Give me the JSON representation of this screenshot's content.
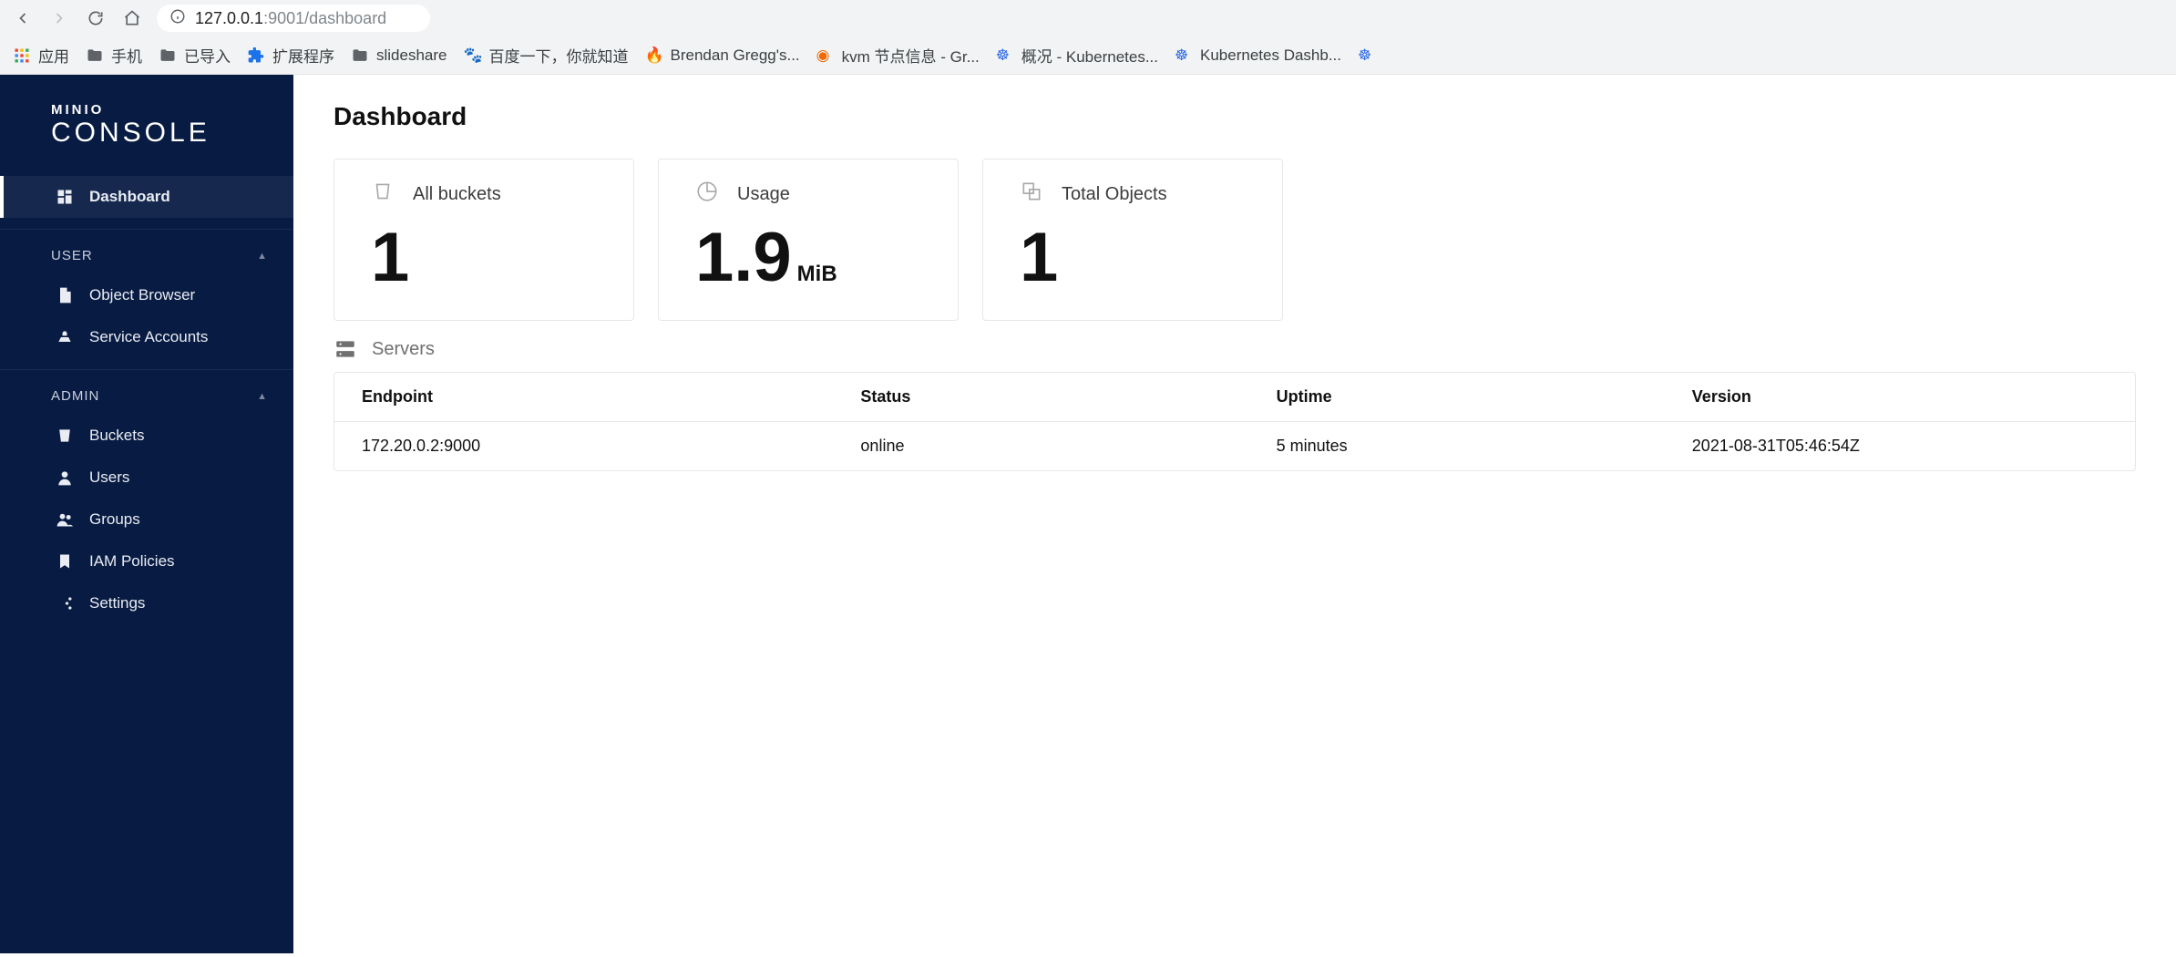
{
  "browser": {
    "url_host": "127.0.0.1",
    "url_port": ":9001",
    "url_path": "/dashboard",
    "bookmarks": [
      "应用",
      "手机",
      "已导入",
      "扩展程序",
      "slideshare",
      "百度一下，你就知道",
      "Brendan Gregg's...",
      "kvm 节点信息 - Gr...",
      "概况 - Kubernetes...",
      "Kubernetes Dashb..."
    ]
  },
  "app": {
    "logo_small": "MINIO",
    "logo_big": "CONSOLE"
  },
  "nav": {
    "dashboard": "Dashboard",
    "section_user": "USER",
    "object_browser": "Object Browser",
    "service_accounts": "Service Accounts",
    "section_admin": "ADMIN",
    "buckets": "Buckets",
    "users": "Users",
    "groups": "Groups",
    "iam_policies": "IAM Policies",
    "settings": "Settings"
  },
  "page": {
    "title": "Dashboard",
    "cards": {
      "all_buckets_label": "All buckets",
      "all_buckets_value": "1",
      "usage_label": "Usage",
      "usage_value": "1.9",
      "usage_unit": "MiB",
      "total_objects_label": "Total Objects",
      "total_objects_value": "1"
    },
    "servers_label": "Servers",
    "table": {
      "cols": {
        "endpoint": "Endpoint",
        "status": "Status",
        "uptime": "Uptime",
        "version": "Version"
      },
      "rows": [
        {
          "endpoint": "172.20.0.2:9000",
          "status": "online",
          "uptime": "5 minutes",
          "version": "2021-08-31T05:46:54Z"
        }
      ]
    }
  }
}
